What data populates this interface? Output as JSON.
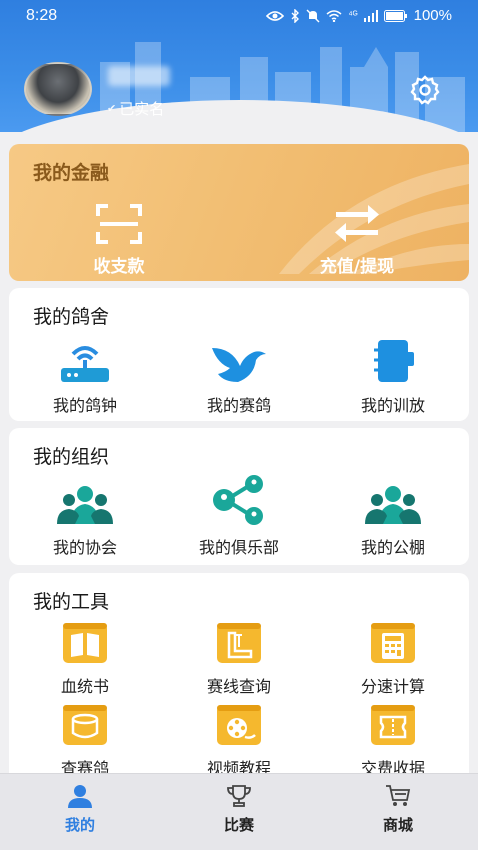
{
  "status_bar": {
    "time": "8:28",
    "network": "⁴ᴳ",
    "battery": "100%"
  },
  "profile": {
    "verified_label": "已实名"
  },
  "finance": {
    "title": "我的金融",
    "actions": [
      {
        "label": "收支款",
        "icon": "scan-icon"
      },
      {
        "label": "充值/提现",
        "icon": "transfer-icon"
      }
    ]
  },
  "loft": {
    "title": "我的鸽舍",
    "items": [
      {
        "label": "我的鸽钟",
        "icon": "router-icon"
      },
      {
        "label": "我的赛鸽",
        "icon": "bird-icon"
      },
      {
        "label": "我的训放",
        "icon": "notebook-icon"
      }
    ]
  },
  "org": {
    "title": "我的组织",
    "items": [
      {
        "label": "我的协会",
        "icon": "group-icon"
      },
      {
        "label": "我的俱乐部",
        "icon": "share-icon"
      },
      {
        "label": "我的公棚",
        "icon": "group-icon"
      }
    ]
  },
  "tools": {
    "title": "我的工具",
    "items": [
      {
        "label": "血统书",
        "icon": "book-icon"
      },
      {
        "label": "赛线查询",
        "icon": "ruler-icon"
      },
      {
        "label": "分速计算",
        "icon": "calculator-icon"
      },
      {
        "label": "查赛鸽",
        "icon": "ring-icon"
      },
      {
        "label": "视频教程",
        "icon": "film-icon"
      },
      {
        "label": "交费收据",
        "icon": "receipt-icon"
      }
    ]
  },
  "tabs": [
    {
      "label": "我的",
      "icon": "person-icon",
      "active": true
    },
    {
      "label": "比赛",
      "icon": "trophy-icon",
      "active": false
    },
    {
      "label": "商城",
      "icon": "cart-icon",
      "active": false
    }
  ],
  "colors": {
    "primary": "#2f7fe0",
    "finance_bg": "#f2bf74",
    "teal": "#1fa89a",
    "tool_yellow": "#f5b82e"
  }
}
